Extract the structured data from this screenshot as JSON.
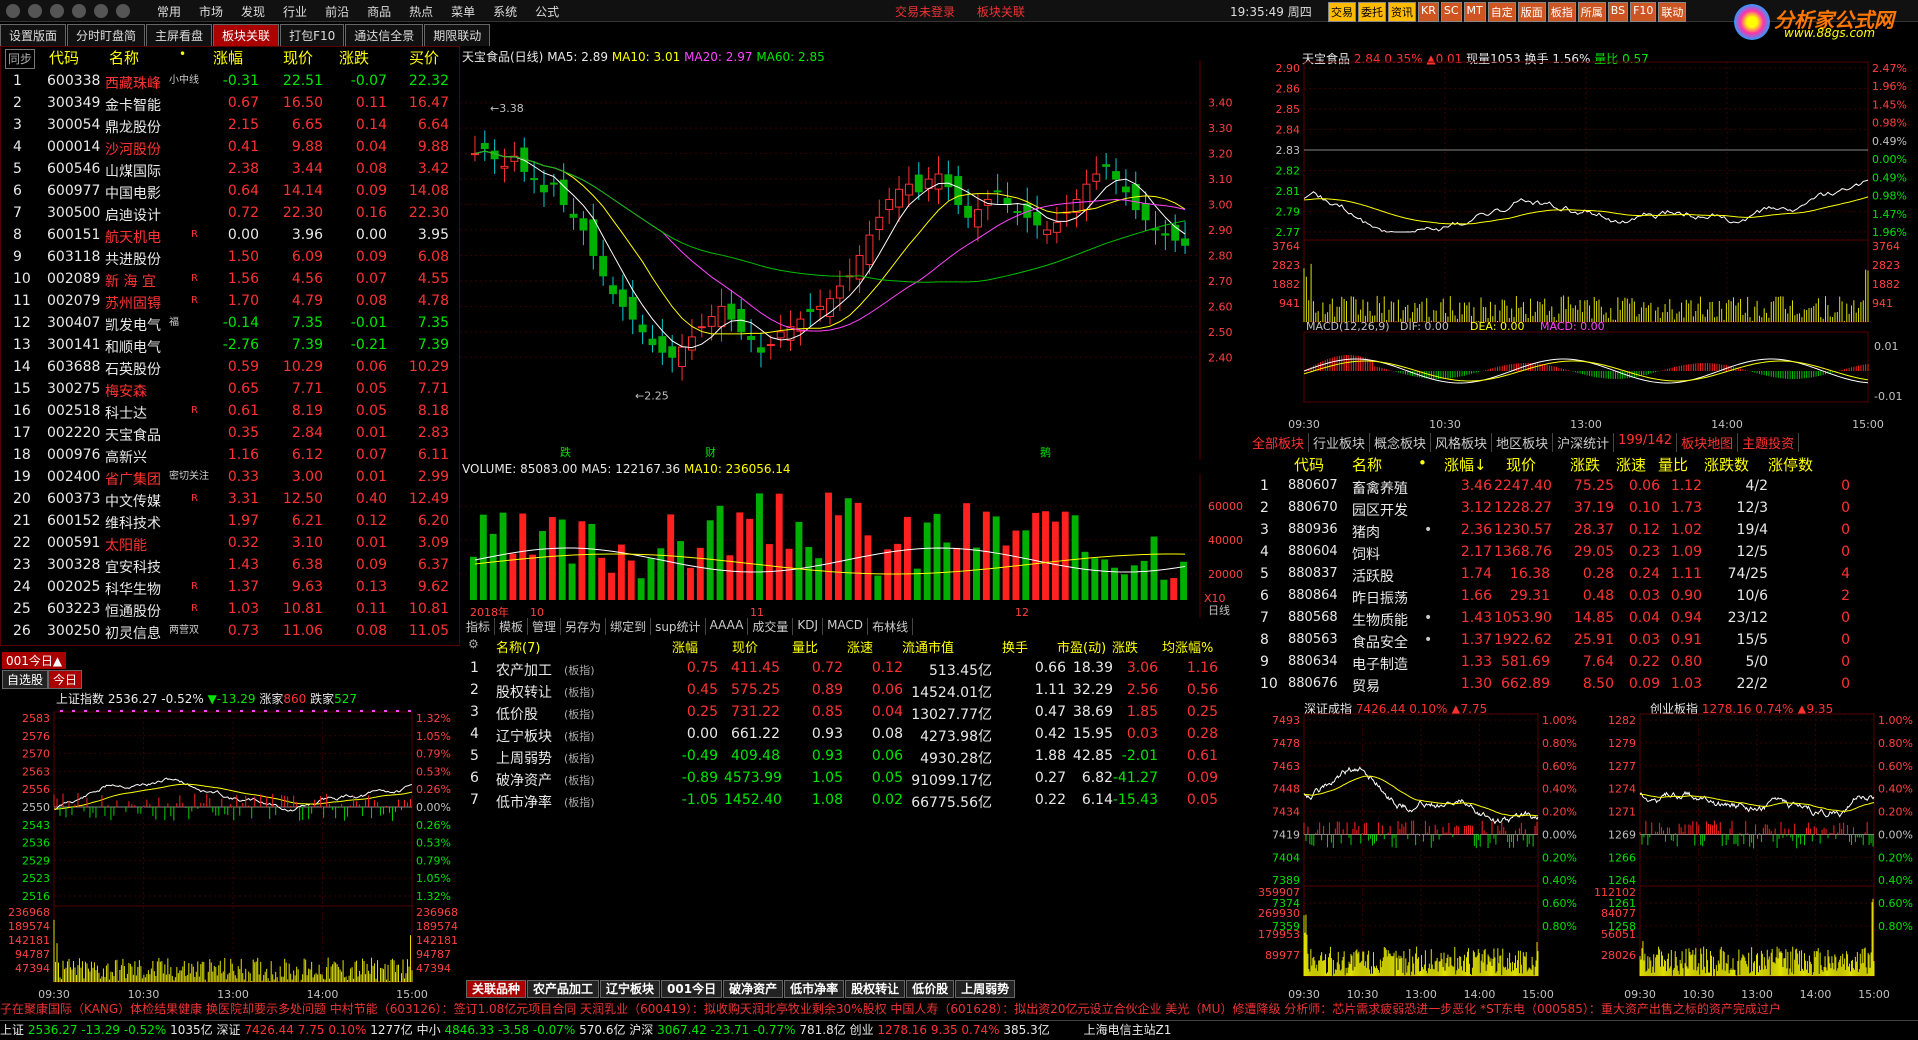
{
  "menu": [
    "常用",
    "市场",
    "发现",
    "行业",
    "前沿",
    "商品",
    "热点",
    "菜单",
    "系统",
    "公式"
  ],
  "center_links": [
    "交易未登录",
    "板块关联"
  ],
  "clock": "19:35:49 周四",
  "tool_buttons": [
    "交易",
    "委托",
    "资讯",
    "KR",
    "SC",
    "MT",
    "自定",
    "版面",
    "板指",
    "所属",
    "BS",
    "F10",
    "联动"
  ],
  "logo": {
    "t1": "分析家公式网",
    "t2": "www.88gs.com"
  },
  "tabs": [
    "设置版面",
    "分时盯盘简",
    "主屏看盘",
    "板块关联",
    "打包F10",
    "通达信全景",
    "期限联动"
  ],
  "list": {
    "headers": [
      "同步",
      "代码",
      "名称",
      "•",
      "涨幅",
      "现价",
      "涨跌",
      "买价"
    ],
    "rows": [
      [
        "1",
        "600338",
        "西藏珠峰",
        "-0.31",
        "22.51",
        "-0.07",
        "22.32",
        "小中线"
      ],
      [
        "2",
        "300349",
        "金卡智能",
        "0.67",
        "16.50",
        "0.11",
        "16.47",
        ""
      ],
      [
        "3",
        "300054",
        "鼎龙股份",
        "2.15",
        "6.65",
        "0.14",
        "6.64",
        ""
      ],
      [
        "4",
        "000014",
        "沙河股份",
        "0.41",
        "9.88",
        "0.04",
        "9.88",
        ""
      ],
      [
        "5",
        "600546",
        "山煤国际",
        "2.38",
        "3.44",
        "0.08",
        "3.42",
        ""
      ],
      [
        "6",
        "600977",
        "中国电影",
        "0.64",
        "14.14",
        "0.09",
        "14.08",
        ""
      ],
      [
        "7",
        "300500",
        "启迪设计",
        "0.72",
        "22.30",
        "0.16",
        "22.30",
        ""
      ],
      [
        "8",
        "600151",
        "航天机电",
        "0.00",
        "3.96",
        "0.00",
        "3.95",
        "R"
      ],
      [
        "9",
        "603118",
        "共进股份",
        "1.50",
        "6.09",
        "0.09",
        "6.08",
        ""
      ],
      [
        "10",
        "002089",
        "新 海 宜",
        "1.56",
        "4.56",
        "0.07",
        "4.55",
        "R"
      ],
      [
        "11",
        "002079",
        "苏州固锝",
        "1.70",
        "4.79",
        "0.08",
        "4.78",
        "R"
      ],
      [
        "12",
        "300407",
        "凯发电气",
        "-0.14",
        "7.35",
        "-0.01",
        "7.35",
        "福"
      ],
      [
        "13",
        "300141",
        "和顺电气",
        "-2.76",
        "7.39",
        "-0.21",
        "7.39",
        ""
      ],
      [
        "14",
        "603688",
        "石英股份",
        "0.59",
        "10.29",
        "0.06",
        "10.29",
        ""
      ],
      [
        "15",
        "300275",
        "梅安森",
        "0.65",
        "7.71",
        "0.05",
        "7.71",
        ""
      ],
      [
        "16",
        "002518",
        "科士达",
        "0.61",
        "8.19",
        "0.05",
        "8.18",
        "R"
      ],
      [
        "17",
        "002220",
        "天宝食品",
        "0.35",
        "2.84",
        "0.01",
        "2.83",
        ""
      ],
      [
        "18",
        "000976",
        "高新兴",
        "1.16",
        "6.12",
        "0.07",
        "6.11",
        ""
      ],
      [
        "19",
        "002400",
        "省广集团",
        "0.33",
        "3.00",
        "0.01",
        "2.99",
        "密切关注"
      ],
      [
        "20",
        "600373",
        "中文传媒",
        "3.31",
        "12.50",
        "0.40",
        "12.49",
        "R"
      ],
      [
        "21",
        "600152",
        "维科技术",
        "1.97",
        "6.21",
        "0.12",
        "6.20",
        ""
      ],
      [
        "22",
        "000591",
        "太阳能",
        "0.32",
        "3.10",
        "0.01",
        "3.09",
        ""
      ],
      [
        "23",
        "300328",
        "宜安科技",
        "1.43",
        "6.38",
        "0.09",
        "6.37",
        ""
      ],
      [
        "24",
        "002025",
        "科华生物",
        "1.37",
        "9.63",
        "0.13",
        "9.62",
        "R"
      ],
      [
        "25",
        "603223",
        "恒通股份",
        "1.03",
        "10.81",
        "0.11",
        "10.81",
        "R"
      ],
      [
        "26",
        "300250",
        "初灵信息",
        "0.73",
        "11.06",
        "0.08",
        "11.05",
        "两营双"
      ]
    ]
  },
  "blocklabel": "001今日▲",
  "subtabs": [
    "自选股",
    "今日"
  ],
  "sh_index": {
    "name": "上证指数",
    "val": "2536.27",
    "pct": "-0.52%",
    "chg": "▼-13.29",
    "up_lbl": "涨家",
    "up": "860",
    "dn_lbl": "跌家",
    "dn": "527",
    "left_ticks": [
      "2583",
      "2576",
      "2570",
      "2563",
      "2556",
      "2550",
      "2543",
      "2536",
      "2529",
      "2523",
      "2516"
    ],
    "right_ticks": [
      "1.32%",
      "1.05%",
      "0.79%",
      "0.53%",
      "0.26%",
      "0.00%",
      "0.26%",
      "0.53%",
      "0.79%",
      "1.05%",
      "1.32%"
    ],
    "vol_ticks": [
      "236968",
      "189574",
      "142181",
      "94787",
      "47394"
    ],
    "time": [
      "09:30",
      "10:30",
      "13:00",
      "14:00",
      "15:00"
    ]
  },
  "kline": {
    "title": "天宝食品(日线)",
    "ma5": "MA5: 2.89",
    "ma10": "MA10: 3.01",
    "ma20": "MA20: 2.97",
    "ma60": "MA60: 2.85",
    "yticks": [
      "3.40",
      "3.30",
      "3.20",
      "3.10",
      "3.00",
      "2.90",
      "2.80",
      "2.70",
      "2.60",
      "2.50",
      "2.40"
    ],
    "hi": "3.38",
    "lo": "2.25",
    "m1": "跌",
    "m2": "财",
    "m3": "鹅"
  },
  "volume": {
    "title": "VOLUME: 85083.00",
    "ma5": "MA5: 122167.36",
    "ma10": "MA10: 236056.14",
    "yticks": [
      "60000",
      "40000",
      "20000"
    ],
    "x10": "X10",
    "xlab": [
      "2018年",
      "10",
      "11",
      "12"
    ],
    "period": "日线"
  },
  "kline_tools": [
    "指标",
    "模板",
    "管理",
    "另存为",
    "绑定到",
    "sup统计",
    "AAAA",
    "成交量",
    "KDJ",
    "MACD",
    "布林线"
  ],
  "sectors": {
    "headers": [
      "名称(7)",
      "涨幅",
      "现价",
      "量比",
      "涨速",
      "流通市值",
      "换手",
      "市盈(动)",
      "涨跌",
      "均涨幅%"
    ],
    "rows": [
      [
        "1",
        "农产加工",
        "(板指)",
        "0.75",
        "411.45",
        "0.72",
        "0.12",
        "513.45亿",
        "0.66",
        "18.39",
        "3.06",
        "1.16"
      ],
      [
        "2",
        "股权转让",
        "(板指)",
        "0.45",
        "575.25",
        "0.89",
        "0.06",
        "14524.01亿",
        "1.11",
        "32.29",
        "2.56",
        "0.56"
      ],
      [
        "3",
        "低价股",
        "(板指)",
        "0.25",
        "731.22",
        "0.85",
        "0.04",
        "13027.77亿",
        "0.47",
        "38.69",
        "1.85",
        "0.25"
      ],
      [
        "4",
        "辽宁板块",
        "(板指)",
        "0.00",
        "661.22",
        "0.93",
        "0.08",
        "4273.98亿",
        "0.42",
        "15.95",
        "0.03",
        "0.28"
      ],
      [
        "5",
        "上周弱势",
        "(板指)",
        "-0.49",
        "409.48",
        "0.93",
        "0.06",
        "4930.28亿",
        "1.88",
        "42.85",
        "-2.01",
        "0.61"
      ],
      [
        "6",
        "破净资产",
        "(板指)",
        "-0.89",
        "4573.99",
        "1.05",
        "0.05",
        "91099.17亿",
        "0.27",
        "6.82",
        "-41.27",
        "0.09"
      ],
      [
        "7",
        "低市净率",
        "(板指)",
        "-1.05",
        "1452.40",
        "1.08",
        "0.02",
        "66775.56亿",
        "0.22",
        "6.14",
        "-15.43",
        "0.05"
      ]
    ]
  },
  "bottom_tabs": [
    "关联品种",
    "农产品加工",
    "辽宁板块",
    "001今日",
    "破净资产",
    "低市净率",
    "股权转让",
    "低价股",
    "上周弱势"
  ],
  "intraday": {
    "name": "天宝食品",
    "price": "2.84",
    "pct": "0.35%",
    "chg": "▲0.01",
    "vol": "现量1053",
    "turn": "换手 1.56%",
    "lb": "量比 0.57",
    "lticks": [
      "2.90",
      "2.86",
      "2.85",
      "2.84",
      "2.83",
      "2.82",
      "2.81",
      "2.79",
      "2.77"
    ],
    "rticks": [
      "2.47%",
      "1.96%",
      "1.45%",
      "0.98%",
      "0.49%",
      "0.00%",
      "0.49%",
      "0.98%",
      "1.47%",
      "1.96%"
    ],
    "vticks": [
      "3764",
      "2823",
      "1882",
      "941"
    ],
    "macd": "MACD(12,26,9)",
    "dif": "DIF: 0.00",
    "dea": "DEA: 0.00",
    "macdv": "MACD: 0.00",
    "mticks": [
      "0.01",
      "-0.01"
    ],
    "time": [
      "09:30",
      "10:30",
      "13:00",
      "14:00",
      "15:00"
    ]
  },
  "industry_tabs": [
    "全部板块",
    "行业板块",
    "概念板块",
    "风格板块",
    "地区板块",
    "沪深统计",
    "199/142",
    "板块地图",
    "主题投资"
  ],
  "industry": {
    "headers": [
      "代码",
      "名称",
      "•",
      "涨幅↓",
      "现价",
      "涨跌",
      "涨速",
      "量比",
      "涨跌数",
      "涨停数"
    ],
    "rows": [
      [
        "1",
        "880607",
        "畜禽养殖",
        "",
        "3.46",
        "2247.40",
        "75.25",
        "0.06",
        "1.12",
        "4/2",
        "0"
      ],
      [
        "2",
        "880670",
        "园区开发",
        "",
        "3.12",
        "1228.27",
        "37.19",
        "0.10",
        "1.73",
        "12/3",
        "0"
      ],
      [
        "3",
        "880936",
        "猪肉",
        "•",
        "2.36",
        "1230.57",
        "28.37",
        "0.12",
        "1.02",
        "19/4",
        "0"
      ],
      [
        "4",
        "880604",
        "饲料",
        "",
        "2.17",
        "1368.76",
        "29.05",
        "0.23",
        "1.09",
        "12/5",
        "0"
      ],
      [
        "5",
        "880837",
        "活跃股",
        "",
        "1.74",
        "16.38",
        "0.28",
        "0.24",
        "1.11",
        "74/25",
        "4"
      ],
      [
        "6",
        "880864",
        "昨日振荡",
        "",
        "1.66",
        "29.31",
        "0.48",
        "0.03",
        "0.90",
        "10/6",
        "2"
      ],
      [
        "7",
        "880568",
        "生物质能",
        "•",
        "1.43",
        "1053.90",
        "14.85",
        "0.04",
        "0.94",
        "23/12",
        "0"
      ],
      [
        "8",
        "880563",
        "食品安全",
        "•",
        "1.37",
        "1922.62",
        "25.91",
        "0.03",
        "0.91",
        "15/5",
        "0"
      ],
      [
        "9",
        "880634",
        "电子制造",
        "",
        "1.33",
        "581.69",
        "7.64",
        "0.22",
        "0.80",
        "5/0",
        "0"
      ],
      [
        "10",
        "880676",
        "贸易",
        "",
        "1.30",
        "662.89",
        "8.50",
        "0.09",
        "1.03",
        "22/2",
        "0"
      ]
    ]
  },
  "sz": {
    "name": "深证成指",
    "val": "7426.44",
    "pct": "0.10%",
    "chg": "▲7.75",
    "lt": [
      "7493",
      "7478",
      "7463",
      "7448",
      "7434",
      "7419",
      "7404",
      "7389",
      "7374",
      "7359"
    ],
    "rt": [
      "1.00%",
      "0.80%",
      "0.60%",
      "0.40%",
      "0.20%",
      "0.00%",
      "0.20%",
      "0.40%",
      "0.60%",
      "0.80%"
    ],
    "vt": [
      "359907",
      "269930",
      "179953",
      "89977"
    ],
    "time": [
      "09:30",
      "10:30",
      "13:00",
      "14:00",
      "15:00"
    ]
  },
  "cy": {
    "name": "创业板指",
    "val": "1278.16",
    "pct": "0.74%",
    "chg": "▲9.35",
    "lt": [
      "1282",
      "1279",
      "1277",
      "1274",
      "1271",
      "1269",
      "1266",
      "1264",
      "1261",
      "1258"
    ],
    "rt": [
      "1.00%",
      "0.80%",
      "0.60%",
      "0.40%",
      "0.20%",
      "0.00%",
      "0.20%",
      "0.40%",
      "0.60%",
      "0.80%"
    ],
    "vt": [
      "112102",
      "84077",
      "56051",
      "28026"
    ],
    "time": [
      "09:30",
      "10:30",
      "13:00",
      "14:00",
      "15:00"
    ]
  },
  "ticker": "子在聚康国际（KANG）体检结果健康 换医院却要示多处问题          中村节能（603126）：签订1.08亿元项目合同          天润乳业（600419）：拟收购天润北亭牧业剩余30%股权          中国人寿（601628）：拟出资20亿元设立合伙企业          美光（MU）修遭降级 分析师：芯片需求疲弱恐进一步恶化          *ST东电（000585）：重大资产出售之标的资产完成过户",
  "status": {
    "sh": "上证",
    "shv": "2536.27",
    "shc": "-13.29",
    "shp": "-0.52%",
    "sha": "1035亿",
    "sz": "深证",
    "szv": "7426.44",
    "szc": "7.75",
    "szp": "0.10%",
    "sza": "1277亿",
    "zx": "中小",
    "zxv": "4846.33",
    "zxc": "-3.58",
    "zxp": "-0.07%",
    "zxa": "570.6亿",
    "hs": "沪深",
    "hsv": "3067.42",
    "hsc": "-23.71",
    "hsp": "-0.77%",
    "hsa": "781.8亿",
    "cy": "创业",
    "cyv": "1278.16",
    "cyc": "9.35",
    "cyp": "0.74%",
    "cya": "385.3亿",
    "server": "上海电信主站Z1"
  }
}
